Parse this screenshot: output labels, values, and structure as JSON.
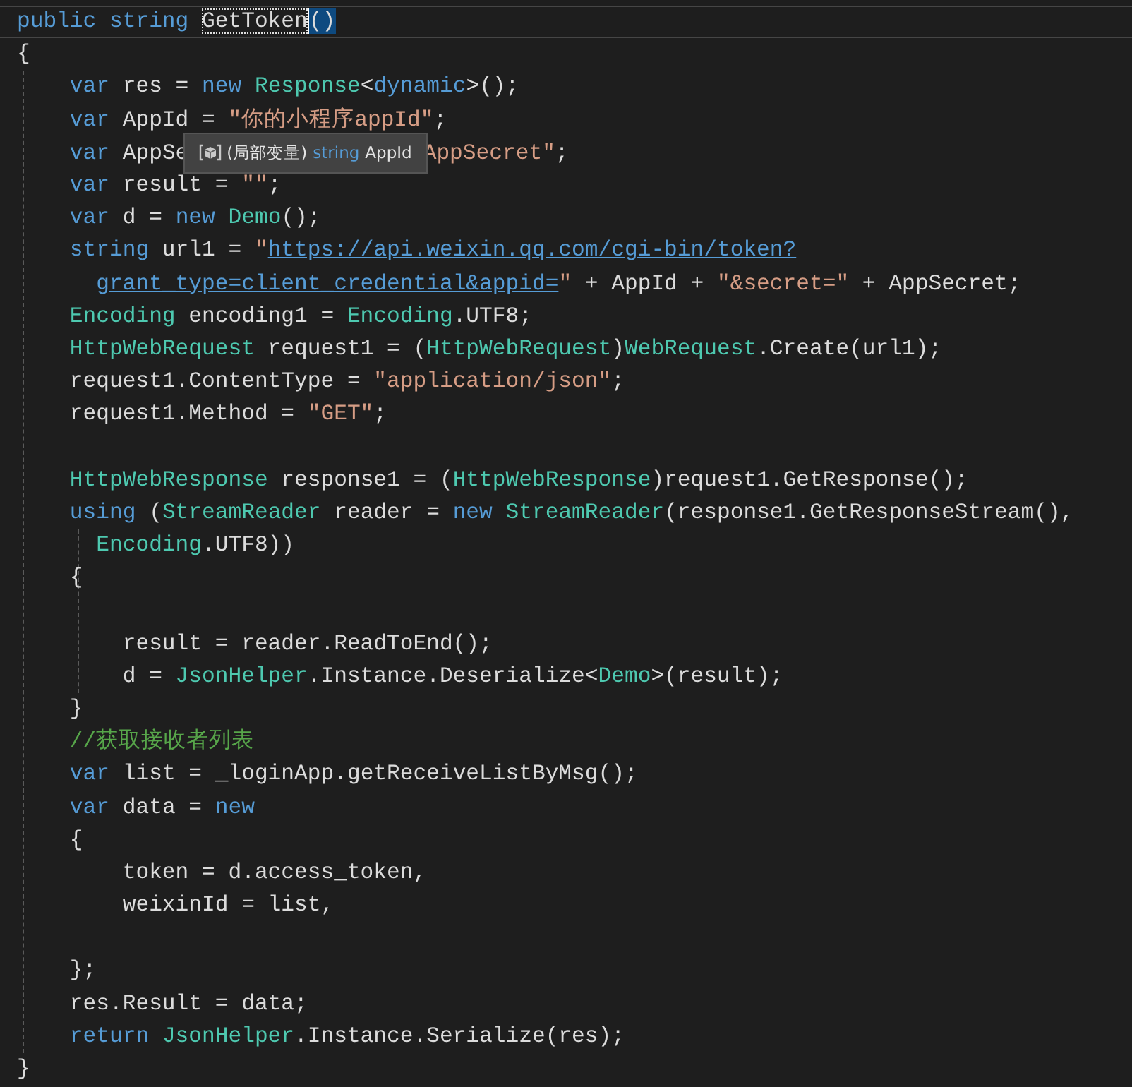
{
  "editor": {
    "items": [
      {
        "kind": "line",
        "current": true,
        "tokens": [
          {
            "kind": "kw",
            "text": "public string "
          },
          {
            "kind": "ident-highlight",
            "text": "GetToken"
          },
          {
            "kind": "brace-match",
            "text": "()"
          }
        ]
      },
      {
        "kind": "line",
        "current": false,
        "tokens": [
          {
            "kind": "plain",
            "text": "{"
          }
        ]
      },
      {
        "kind": "block",
        "children": [
          {
            "kind": "line",
            "current": false,
            "tokens": [
              {
                "kind": "kw",
                "text": "    var"
              },
              {
                "kind": "plain",
                "text": " res = "
              },
              {
                "kind": "kw",
                "text": "new "
              },
              {
                "kind": "type",
                "text": "Response"
              },
              {
                "kind": "plain",
                "text": "<"
              },
              {
                "kind": "kw",
                "text": "dynamic"
              },
              {
                "kind": "plain",
                "text": ">();"
              }
            ]
          },
          {
            "kind": "line",
            "current": false,
            "tokens": [
              {
                "kind": "kw",
                "text": "    var"
              },
              {
                "kind": "plain",
                "text": " AppId = "
              },
              {
                "kind": "str",
                "text": "\"你的小程序appId\""
              },
              {
                "kind": "plain",
                "text": ";"
              }
            ]
          },
          {
            "kind": "line",
            "current": false,
            "tokens": [
              {
                "kind": "kw",
                "text": "    var"
              },
              {
                "kind": "plain",
                "text": " AppSe"
              },
              {
                "kind": "tooltip",
                "label": "(局部变量)",
                "type": "string",
                "symbol": "AppId"
              },
              {
                "kind": "str",
                "text": "AppSecret\""
              },
              {
                "kind": "plain",
                "text": ";"
              }
            ]
          },
          {
            "kind": "line",
            "current": false,
            "tokens": [
              {
                "kind": "kw",
                "text": "    var"
              },
              {
                "kind": "plain",
                "text": " result = "
              },
              {
                "kind": "str",
                "text": "\"\""
              },
              {
                "kind": "plain",
                "text": ";"
              }
            ]
          },
          {
            "kind": "line",
            "current": false,
            "tokens": [
              {
                "kind": "kw",
                "text": "    var"
              },
              {
                "kind": "plain",
                "text": " d = "
              },
              {
                "kind": "kw",
                "text": "new "
              },
              {
                "kind": "type",
                "text": "Demo"
              },
              {
                "kind": "plain",
                "text": "();"
              }
            ]
          },
          {
            "kind": "line",
            "current": false,
            "tokens": [
              {
                "kind": "kw",
                "text": "    string"
              },
              {
                "kind": "plain",
                "text": " url1 = "
              },
              {
                "kind": "str",
                "text": "\""
              },
              {
                "kind": "url",
                "text": "https://api.weixin.qq.com/cgi-bin/token?"
              }
            ]
          },
          {
            "kind": "line",
            "current": false,
            "tokens": [
              {
                "kind": "url",
                "text": "      grant_type=client_credential&appid="
              },
              {
                "kind": "str",
                "text": "\""
              },
              {
                "kind": "plain",
                "text": " + AppId + "
              },
              {
                "kind": "str",
                "text": "\"&secret=\""
              },
              {
                "kind": "plain",
                "text": " + AppSecret;"
              }
            ]
          },
          {
            "kind": "line",
            "current": false,
            "tokens": [
              {
                "kind": "type",
                "text": "    Encoding"
              },
              {
                "kind": "plain",
                "text": " encoding1 = "
              },
              {
                "kind": "type",
                "text": "Encoding"
              },
              {
                "kind": "plain",
                "text": ".UTF8;"
              }
            ]
          },
          {
            "kind": "line",
            "current": false,
            "tokens": [
              {
                "kind": "type",
                "text": "    HttpWebRequest"
              },
              {
                "kind": "plain",
                "text": " request1 = ("
              },
              {
                "kind": "type",
                "text": "HttpWebRequest"
              },
              {
                "kind": "plain",
                "text": ")"
              },
              {
                "kind": "type",
                "text": "WebRequest"
              },
              {
                "kind": "plain",
                "text": ".Create(url1);"
              }
            ]
          },
          {
            "kind": "line",
            "current": false,
            "tokens": [
              {
                "kind": "plain",
                "text": "    request1.ContentType = "
              },
              {
                "kind": "str",
                "text": "\"application/json\""
              },
              {
                "kind": "plain",
                "text": ";"
              }
            ]
          },
          {
            "kind": "line",
            "current": false,
            "tokens": [
              {
                "kind": "plain",
                "text": "    request1.Method = "
              },
              {
                "kind": "str",
                "text": "\"GET\""
              },
              {
                "kind": "plain",
                "text": ";"
              }
            ]
          },
          {
            "kind": "line",
            "current": false
          },
          {
            "kind": "line",
            "current": false,
            "tokens": [
              {
                "kind": "type",
                "text": "    HttpWebResponse"
              },
              {
                "kind": "plain",
                "text": " response1 = ("
              },
              {
                "kind": "type",
                "text": "HttpWebResponse"
              },
              {
                "kind": "plain",
                "text": ")request1.GetResponse();"
              }
            ]
          },
          {
            "kind": "line",
            "current": false,
            "tokens": [
              {
                "kind": "kw",
                "text": "    using"
              },
              {
                "kind": "plain",
                "text": " ("
              },
              {
                "kind": "type",
                "text": "StreamReader"
              },
              {
                "kind": "plain",
                "text": " reader = "
              },
              {
                "kind": "kw",
                "text": "new "
              },
              {
                "kind": "type",
                "text": "StreamReader"
              },
              {
                "kind": "plain",
                "text": "(response1.GetResponseStream(),"
              }
            ]
          },
          {
            "kind": "block",
            "children": [
              {
                "kind": "line",
                "current": false,
                "tokens": [
                  {
                    "kind": "type",
                    "text": "      Encoding"
                  },
                  {
                    "kind": "plain",
                    "text": ".UTF8))"
                  }
                ]
              },
              {
                "kind": "line",
                "current": false,
                "tokens": [
                  {
                    "kind": "plain",
                    "text": "    {"
                  }
                ]
              },
              {
                "kind": "line",
                "current": false
              },
              {
                "kind": "line",
                "current": false,
                "tokens": [
                  {
                    "kind": "plain",
                    "text": "        result = reader.ReadToEnd();"
                  }
                ]
              },
              {
                "kind": "line",
                "current": false,
                "tokens": [
                  {
                    "kind": "plain",
                    "text": "        d = "
                  },
                  {
                    "kind": "type",
                    "text": "JsonHelper"
                  },
                  {
                    "kind": "plain",
                    "text": ".Instance.Deserialize<"
                  },
                  {
                    "kind": "type",
                    "text": "Demo"
                  },
                  {
                    "kind": "plain",
                    "text": ">(result);"
                  }
                ]
              }
            ]
          },
          {
            "kind": "line",
            "current": false,
            "tokens": [
              {
                "kind": "plain",
                "text": "    }"
              }
            ]
          },
          {
            "kind": "line",
            "current": false,
            "tokens": [
              {
                "kind": "comment",
                "text": "    //获取接收者列表"
              }
            ]
          },
          {
            "kind": "line",
            "current": false,
            "tokens": [
              {
                "kind": "kw",
                "text": "    var"
              },
              {
                "kind": "plain",
                "text": " list = _loginApp.getReceiveListByMsg();"
              }
            ]
          },
          {
            "kind": "line",
            "current": false,
            "tokens": [
              {
                "kind": "kw",
                "text": "    var"
              },
              {
                "kind": "plain",
                "text": " data = "
              },
              {
                "kind": "kw",
                "text": "new"
              }
            ]
          },
          {
            "kind": "line",
            "current": false,
            "tokens": [
              {
                "kind": "plain",
                "text": "    {"
              }
            ]
          },
          {
            "kind": "line",
            "current": false,
            "tokens": [
              {
                "kind": "plain",
                "text": "        token = d.access_token,"
              }
            ]
          },
          {
            "kind": "line",
            "current": false,
            "tokens": [
              {
                "kind": "plain",
                "text": "        weixinId = list,"
              }
            ]
          },
          {
            "kind": "line",
            "current": false
          },
          {
            "kind": "line",
            "current": false,
            "tokens": [
              {
                "kind": "plain",
                "text": "    };"
              }
            ]
          },
          {
            "kind": "line",
            "current": false,
            "tokens": [
              {
                "kind": "plain",
                "text": "    res.Result = data;"
              }
            ]
          },
          {
            "kind": "line",
            "current": false,
            "tokens": [
              {
                "kind": "kw",
                "text": "    return "
              },
              {
                "kind": "type",
                "text": "JsonHelper"
              },
              {
                "kind": "plain",
                "text": ".Instance.Serialize(res);"
              }
            ]
          }
        ]
      },
      {
        "kind": "line",
        "current": false,
        "tokens": [
          {
            "kind": "plain",
            "text": "}"
          }
        ]
      }
    ]
  }
}
